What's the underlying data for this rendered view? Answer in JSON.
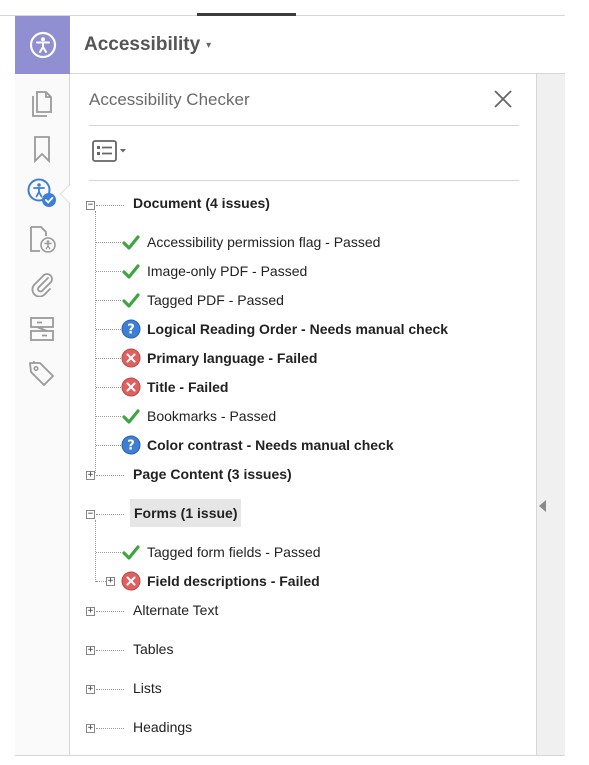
{
  "header": {
    "title": "Accessibility",
    "caret": "▾"
  },
  "rail": {
    "icons": [
      "pages-icon",
      "bookmark-icon",
      "accessibility-check-icon",
      "accessibility-doc-icon",
      "attachment-icon",
      "compare-icon",
      "tags-icon"
    ]
  },
  "panel": {
    "title": "Accessibility Checker",
    "close_icon": "close-icon",
    "options_icon": "options-list-icon"
  },
  "tree": {
    "document": {
      "label": "Document (4 issues)",
      "expanded": true,
      "items": [
        {
          "text": "Accessibility permission flag - Passed",
          "status": "passed"
        },
        {
          "text": "Image-only PDF - Passed",
          "status": "passed"
        },
        {
          "text": "Tagged PDF - Passed",
          "status": "passed"
        },
        {
          "text": "Logical Reading Order - Needs manual check",
          "status": "manual"
        },
        {
          "text": "Primary language - Failed",
          "status": "failed"
        },
        {
          "text": "Title - Failed",
          "status": "failed"
        },
        {
          "text": "Bookmarks - Passed",
          "status": "passed"
        },
        {
          "text": "Color contrast - Needs manual check",
          "status": "manual"
        }
      ]
    },
    "page_content": {
      "label": "Page Content (3 issues)",
      "expanded": false
    },
    "forms": {
      "label": "Forms (1 issue)",
      "expanded": true,
      "items": [
        {
          "text": "Tagged form fields - Passed",
          "status": "passed"
        },
        {
          "text": "Field descriptions - Failed",
          "status": "failed"
        }
      ]
    },
    "alternate_text": {
      "label": "Alternate Text",
      "expanded": false
    },
    "tables": {
      "label": "Tables",
      "expanded": false
    },
    "lists": {
      "label": "Lists",
      "expanded": false
    },
    "headings": {
      "label": "Headings",
      "expanded": false
    }
  },
  "colors": {
    "accent": "#8f8fd1",
    "passed": "#3fa63f",
    "failed": "#e06060",
    "manual": "#3d7fd6"
  }
}
